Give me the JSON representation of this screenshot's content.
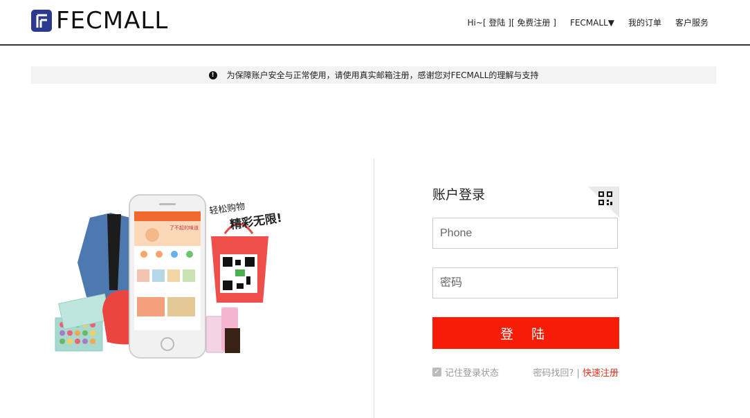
{
  "brand": {
    "name": "FECMALL",
    "color": "#2b3990"
  },
  "nav": {
    "greeting": "Hi~",
    "login": "[ 登陆 ]",
    "register": "[ 免费注册 ]",
    "store": "FECMALL▼",
    "orders": "我的订单",
    "service": "客户服务"
  },
  "notice": {
    "icon": "exclamation-circle-icon",
    "text": "为保障账户安全与正常使用，请使用真实邮箱注册，感谢您对FECMALL的理解与支持"
  },
  "promo": {
    "slogan_line1": "轻松购物",
    "slogan_line2": "精彩无限!",
    "phone_banner": "了不起的味道"
  },
  "login": {
    "title": "账户登录",
    "phone_placeholder": "Phone",
    "password_placeholder": "密码",
    "submit_label": "登 陆",
    "remember_label": "记住登录状态",
    "remember_checked": true,
    "forgot_label": "密码找回?",
    "separator": "|",
    "register_label": "快速注册",
    "accent_color": "#f71c05"
  }
}
